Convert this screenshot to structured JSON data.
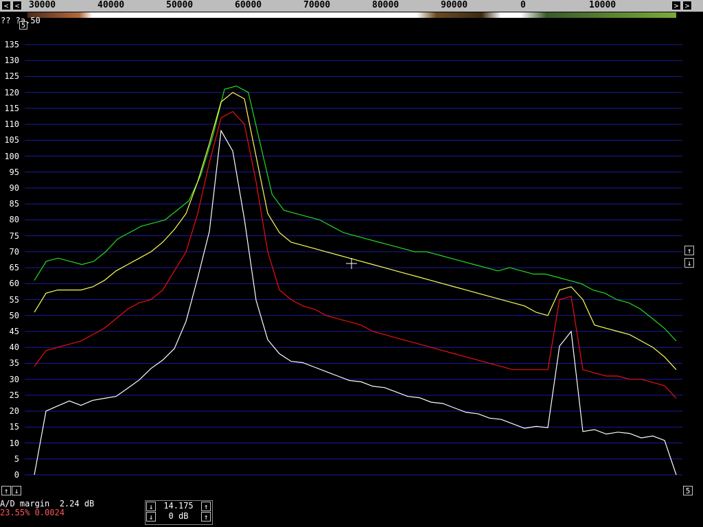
{
  "freq_axis": {
    "labels": [
      "30000",
      "40000",
      "50000",
      "60000",
      "70000",
      "80000",
      "90000",
      "0",
      "10000"
    ]
  },
  "top_left_text": "?? ?a.50",
  "top_left_box": "5",
  "y_axis": {
    "labels": [
      "135",
      "130",
      "125",
      "120",
      "115",
      "110",
      "105",
      "100",
      "95",
      "90",
      "85",
      "80",
      "75",
      "70",
      "65",
      "60",
      "55",
      "50",
      "45",
      "40",
      "35",
      "30",
      "25",
      "20",
      "15",
      "10",
      "5",
      "0"
    ]
  },
  "status": {
    "ad_margin": "A/D margin  2.24 dB",
    "cpu": "23.55% 0.0024"
  },
  "center_controls": {
    "value1": "14.175",
    "value2": "0 dB"
  },
  "buttons": {
    "left_arrow": "<",
    "right_arrow": ">",
    "up_arrow": "↑",
    "down_arrow": "↓",
    "bottom_right": "5"
  },
  "colors": {
    "background": "#000000",
    "grid": "#1a1aa0",
    "trace_green": "#22dd22",
    "trace_yellow": "#ffff55",
    "trace_red": "#ee1010",
    "trace_white": "#ffffff",
    "cpu_text": "#ff5555"
  },
  "chart_data": {
    "type": "line",
    "ylim": [
      0,
      135
    ],
    "series": [
      {
        "color": "#22dd22",
        "values": [
          61,
          67,
          68,
          67,
          66,
          67,
          70,
          74,
          76,
          78,
          79,
          80,
          83,
          86,
          94,
          106,
          121,
          122,
          120,
          104,
          88,
          83,
          82,
          81,
          80,
          78,
          76,
          75,
          74,
          73,
          72,
          71,
          70,
          70,
          69,
          68,
          67,
          66,
          65,
          64,
          65,
          64,
          63,
          63,
          62,
          61,
          60,
          58,
          57,
          55,
          54,
          52,
          49,
          46,
          42
        ]
      },
      {
        "color": "#ffff55",
        "values": [
          51,
          57,
          58,
          58,
          58,
          59,
          61,
          64,
          66,
          68,
          70,
          73,
          77,
          82,
          92,
          104,
          117,
          120,
          118,
          100,
          82,
          76,
          73,
          72,
          71,
          70,
          69,
          68,
          67,
          66,
          65,
          64,
          63,
          62,
          61,
          60,
          59,
          58,
          57,
          56,
          55,
          54,
          53,
          51,
          50,
          58,
          59,
          55,
          47,
          46,
          45,
          44,
          42,
          40,
          37,
          33
        ]
      },
      {
        "color": "#ee1010",
        "values": [
          34,
          39,
          40,
          41,
          42,
          44,
          46,
          49,
          52,
          54,
          55,
          58,
          64,
          70,
          82,
          98,
          112,
          114,
          110,
          92,
          70,
          58,
          55,
          53,
          52,
          50,
          49,
          48,
          47,
          45,
          44,
          43,
          42,
          41,
          40,
          39,
          38,
          37,
          36,
          35,
          34,
          33,
          33,
          33,
          33,
          55,
          56,
          33,
          32,
          31,
          31,
          30,
          30,
          29,
          28,
          24
        ]
      },
      {
        "color": "#ffffff",
        "values": [
          0,
          20,
          22,
          23,
          22,
          23,
          24,
          25,
          27,
          30,
          33,
          36,
          40,
          48,
          62,
          76,
          108,
          102,
          80,
          55,
          42,
          38,
          36,
          35,
          34,
          32,
          31,
          30,
          29,
          28,
          27,
          26,
          25,
          24,
          23,
          22,
          21,
          20,
          19,
          18,
          17,
          16,
          15,
          15,
          15,
          40,
          45,
          14,
          14,
          13,
          13,
          13,
          12,
          12,
          11,
          0
        ]
      }
    ]
  }
}
